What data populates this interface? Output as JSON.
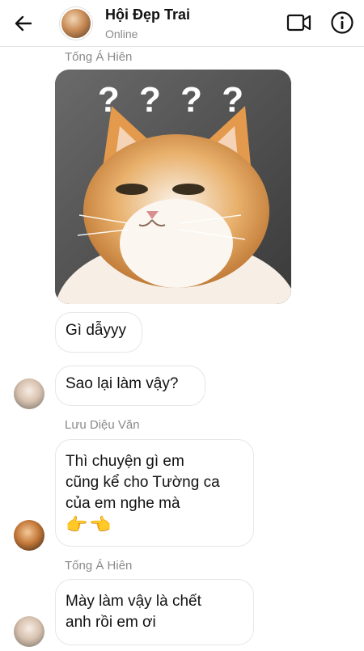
{
  "header": {
    "title": "Hội Đẹp Trai",
    "status": "Online",
    "back_icon": "arrow-left-icon",
    "video_icon": "video-camera-icon",
    "info_icon": "info-icon"
  },
  "messages": [
    {
      "sender": "Tống Á Hiên",
      "type": "image",
      "image_desc": "cat-with-question-marks",
      "overlay_text": "? ? ? ?"
    },
    {
      "type": "text",
      "text": "Gì dẫyyy"
    },
    {
      "type": "text",
      "text": "Sao lại làm vậy?"
    },
    {
      "sender": "Lưu Diệu Văn",
      "type": "text",
      "lines": [
        "Thì chuyện gì em",
        "cũng kể cho Tường ca",
        "của em nghe mà"
      ],
      "emoji": "👉👈"
    },
    {
      "sender": "Tống Á Hiên",
      "type": "text",
      "lines": [
        "Mày làm vậy là chết",
        "anh rồi em ơi"
      ]
    }
  ],
  "colors": {
    "bubble_border": "#e6e6e6",
    "muted_text": "#8a8a8a"
  }
}
